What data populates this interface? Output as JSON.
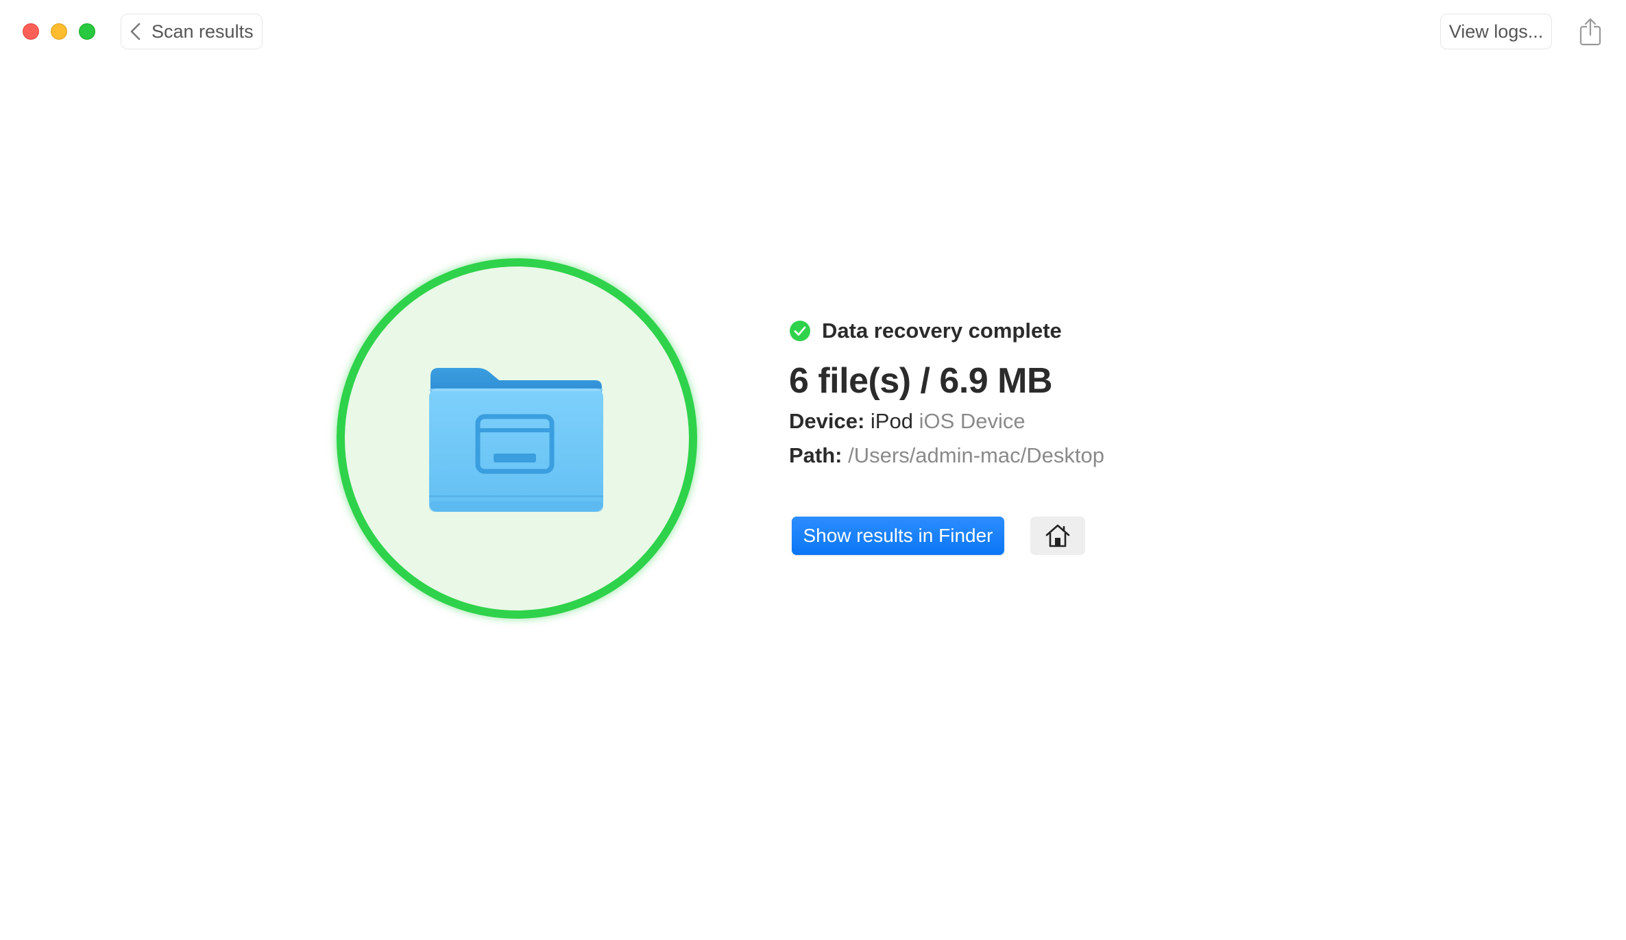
{
  "titlebar": {
    "back_label": "Scan results",
    "logs_label": "View logs..."
  },
  "result": {
    "status": "Data recovery complete",
    "summary": "6 file(s) / 6.9 MB",
    "device_key": "Device:",
    "device_name": "iPod",
    "device_type": "iOS Device",
    "path_key": "Path:",
    "path_value": "/Users/admin-mac/Desktop"
  },
  "actions": {
    "finder_label": "Show results in Finder"
  },
  "colors": {
    "accent": "#0a7fff",
    "success": "#2fd24b",
    "folder": "#6ec8f7"
  },
  "icons": {
    "back": "chevron-left-icon",
    "share": "share-icon",
    "status": "checkmark-circle-icon",
    "folder": "folder-icon",
    "home": "home-icon"
  }
}
